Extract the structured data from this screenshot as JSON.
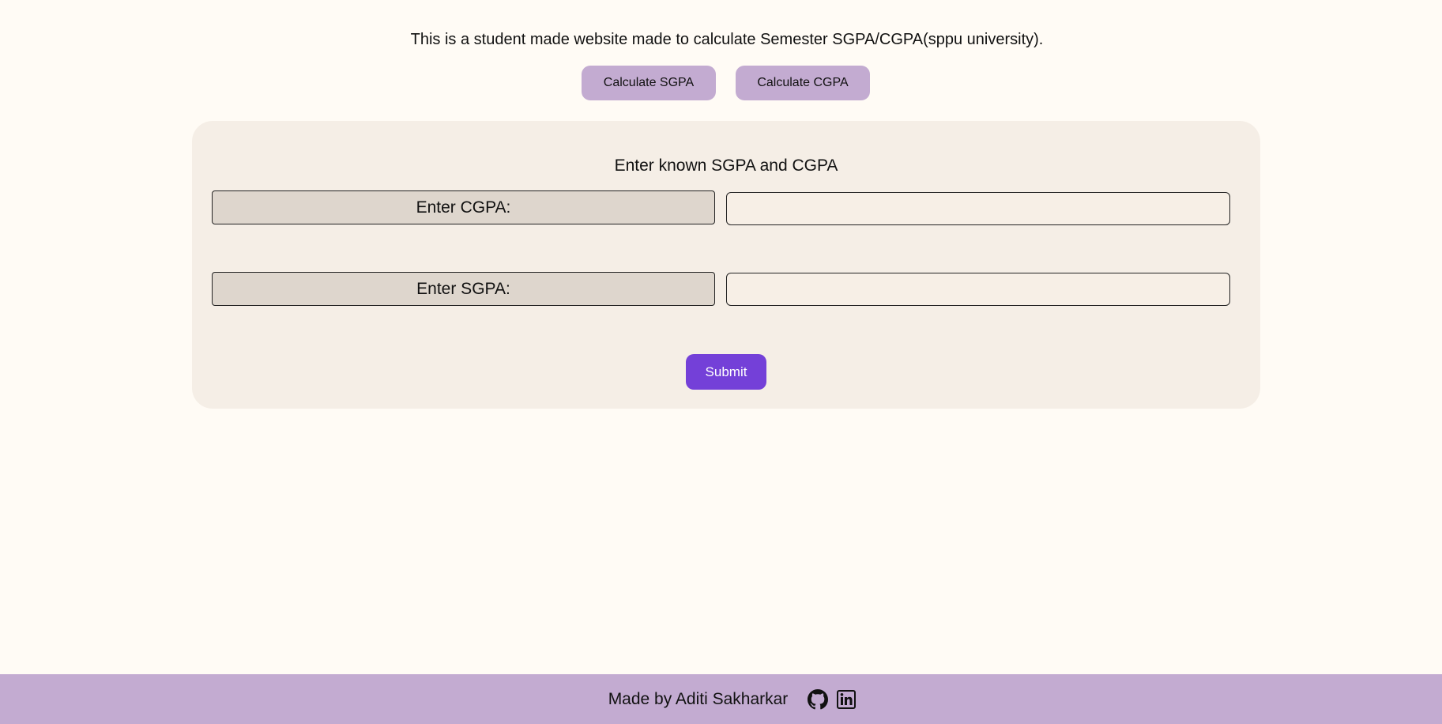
{
  "header": {
    "intro_text": "This is a student made website made to calculate Semester SGPA/CGPA(sppu university)."
  },
  "mode_buttons": {
    "sgpa_label": "Calculate SGPA",
    "cgpa_label": "Calculate CGPA"
  },
  "form": {
    "title": "Enter known SGPA and CGPA",
    "cgpa_label": "Enter CGPA:",
    "cgpa_value": "",
    "sgpa_label": "Enter SGPA:",
    "sgpa_value": "",
    "submit_label": "Submit"
  },
  "footer": {
    "credit_text": "Made by Aditi Sakharkar",
    "icons": [
      "github-icon",
      "linkedin-icon"
    ]
  },
  "colors": {
    "background": "#fffbf5",
    "panel": "#f5eee6",
    "mode_button": "#c3abd1",
    "submit_button": "#7440d8",
    "footer": "#c3abd1"
  }
}
